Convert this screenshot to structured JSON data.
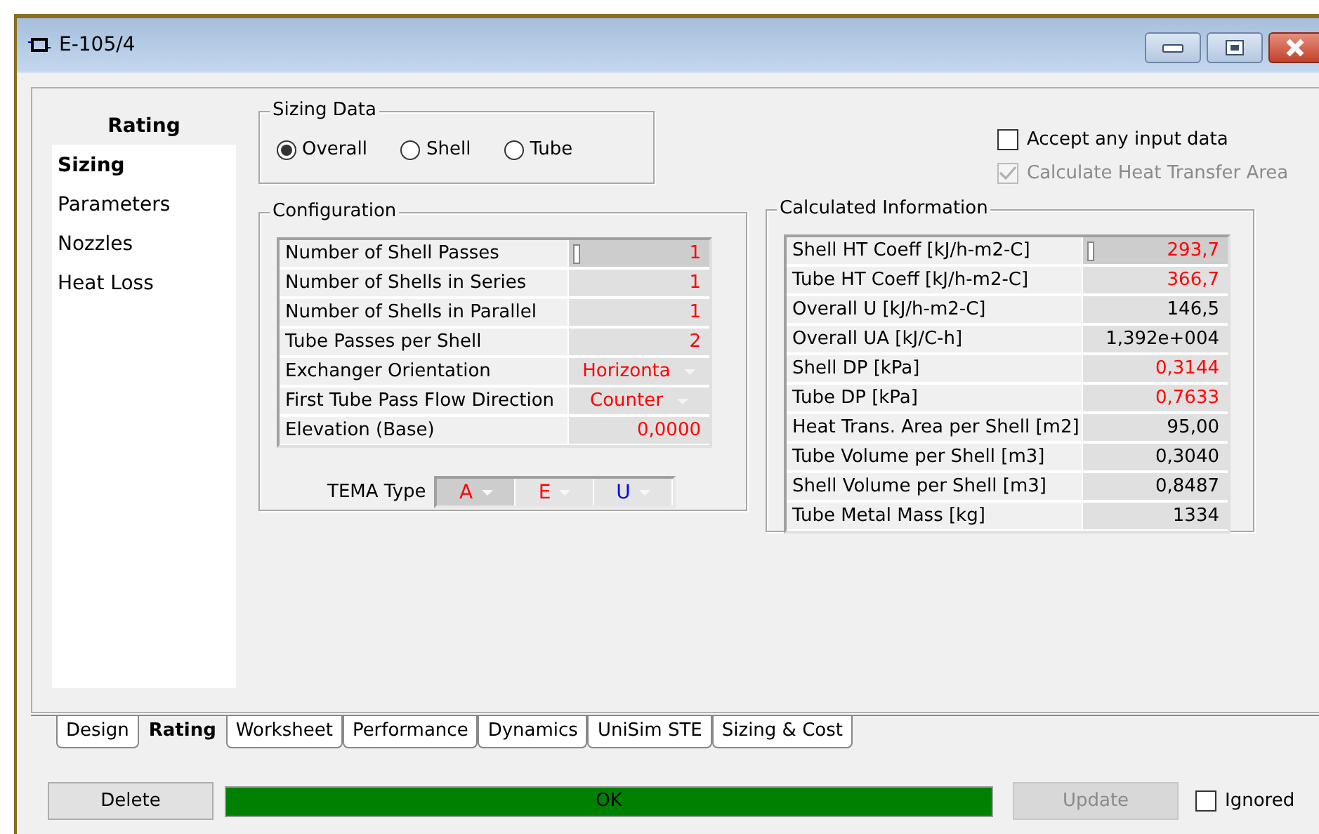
{
  "window": {
    "title": "E-105/4"
  },
  "sidebar": {
    "heading": "Rating",
    "items": [
      {
        "label": "Sizing",
        "selected": true
      },
      {
        "label": "Parameters",
        "selected": false
      },
      {
        "label": "Nozzles",
        "selected": false
      },
      {
        "label": "Heat Loss",
        "selected": false
      }
    ]
  },
  "sizing_data": {
    "title": "Sizing Data",
    "options": [
      {
        "label": "Overall",
        "selected": true
      },
      {
        "label": "Shell",
        "selected": false
      },
      {
        "label": "Tube",
        "selected": false
      }
    ]
  },
  "checkboxes": [
    {
      "label": "Accept any input data",
      "checked": false,
      "disabled": false
    },
    {
      "label": "Calculate Heat Transfer Area",
      "checked": true,
      "disabled": true
    }
  ],
  "configuration": {
    "title": "Configuration",
    "rows": [
      {
        "label": "Number of Shell Passes",
        "value": "1",
        "color": "#ff0000",
        "kind": "number",
        "focused": true
      },
      {
        "label": "Number of Shells in Series",
        "value": "1",
        "color": "#ff0000",
        "kind": "number",
        "focused": false
      },
      {
        "label": "Number of Shells in Parallel",
        "value": "1",
        "color": "#ff0000",
        "kind": "number",
        "focused": false
      },
      {
        "label": "Tube Passes per Shell",
        "value": "2",
        "color": "#ff0000",
        "kind": "number",
        "focused": false
      },
      {
        "label": "Exchanger Orientation",
        "value": "Horizonta",
        "color": "#ff0000",
        "kind": "dropdown",
        "focused": false
      },
      {
        "label": "First Tube Pass Flow Direction",
        "value": "Counter",
        "color": "#ff0000",
        "kind": "dropdown",
        "focused": false
      },
      {
        "label": "Elevation (Base)",
        "value": "0,0000",
        "color": "#ff0000",
        "kind": "number",
        "focused": false
      }
    ],
    "tema": {
      "label": "TEMA Type",
      "parts": [
        {
          "value": "A",
          "color": "#ff0000",
          "selected": true
        },
        {
          "value": "E",
          "color": "#ff0000",
          "selected": false
        },
        {
          "value": "U",
          "color": "#0000ff",
          "selected": false
        }
      ]
    }
  },
  "calculated": {
    "title": "Calculated Information",
    "rows": [
      {
        "label": "Shell HT Coeff [kJ/h-m2-C]",
        "value": "293,7",
        "color": "#ff0000",
        "focused": true
      },
      {
        "label": "Tube HT Coeff [kJ/h-m2-C]",
        "value": "366,7",
        "color": "#ff0000",
        "focused": false
      },
      {
        "label": "Overall U [kJ/h-m2-C]",
        "value": "146,5",
        "color": "#000000",
        "focused": false
      },
      {
        "label": "Overall UA [kJ/C-h]",
        "value": "1,392e+004",
        "color": "#000000",
        "focused": false
      },
      {
        "label": "Shell DP [kPa]",
        "value": "0,3144",
        "color": "#ff0000",
        "focused": false
      },
      {
        "label": "Tube DP [kPa]",
        "value": "0,7633",
        "color": "#ff0000",
        "focused": false
      },
      {
        "label": "Heat Trans. Area per Shell [m2]",
        "value": "95,00",
        "color": "#000000",
        "focused": false
      },
      {
        "label": "Tube Volume per Shell [m3]",
        "value": "0,3040",
        "color": "#000000",
        "focused": false
      },
      {
        "label": "Shell Volume per Shell [m3]",
        "value": "0,8487",
        "color": "#000000",
        "focused": false
      },
      {
        "label": "Tube Metal Mass [kg]",
        "value": "1334",
        "color": "#000000",
        "focused": false
      }
    ]
  },
  "tabs": [
    {
      "label": "Design",
      "selected": false
    },
    {
      "label": "Rating",
      "selected": true
    },
    {
      "label": "Worksheet",
      "selected": false
    },
    {
      "label": "Performance",
      "selected": false
    },
    {
      "label": "Dynamics",
      "selected": false
    },
    {
      "label": "UniSim STE",
      "selected": false
    },
    {
      "label": "Sizing & Cost",
      "selected": false
    }
  ],
  "footer": {
    "delete": {
      "label": "Delete",
      "disabled": false
    },
    "status": {
      "text": "OK",
      "color": "#008000"
    },
    "update": {
      "label": "Update",
      "disabled": true
    },
    "ignored": {
      "label": "Ignored",
      "checked": false
    }
  }
}
